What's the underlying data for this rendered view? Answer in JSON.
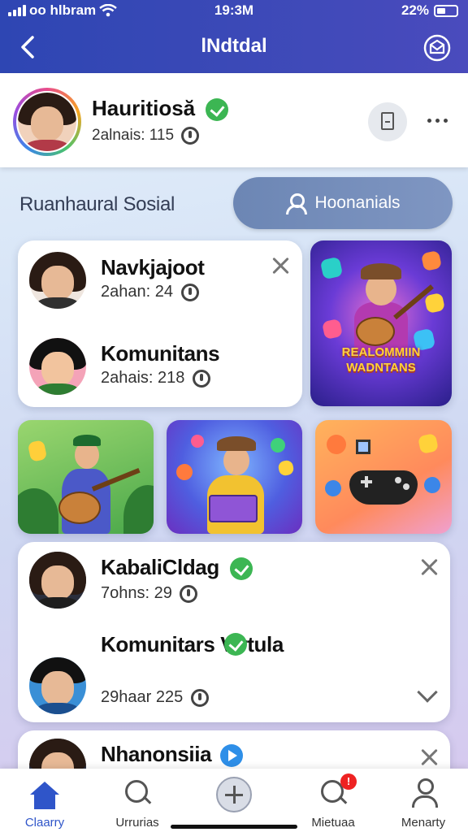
{
  "status_bar": {
    "carrier": "oo hlbram",
    "time": "19:3M",
    "battery": "22%"
  },
  "header": {
    "title": "lNdtdal"
  },
  "profile": {
    "name": "Hauritiosă",
    "sub": "2alnais: 115"
  },
  "section": {
    "title": "Ruanhaural Sosial",
    "button_label": "Hoonanials"
  },
  "card1": {
    "rows": [
      {
        "name": "Navkjajoot",
        "sub": "2ahan: 24"
      },
      {
        "name": "Komunitans",
        "sub": "2ahais: 218"
      }
    ]
  },
  "tiles": {
    "banner_text": "REALOMMIIN WADNTANS"
  },
  "card2": {
    "rows": [
      {
        "name": "KabaliCldag",
        "sub": "7ohns: 29"
      },
      {
        "name": "Komunitars Virtula",
        "sub": "29haar 225"
      }
    ]
  },
  "card3": {
    "name": "Nhanonsiia"
  },
  "bottom_nav": {
    "items": [
      {
        "label": "Claarry"
      },
      {
        "label": "Urrurias"
      },
      {
        "label": ""
      },
      {
        "label": "Mietuaa",
        "badge": "!"
      },
      {
        "label": "Menarty"
      }
    ]
  },
  "colors": {
    "top_bar": "#3a48b6",
    "accent_blue": "#2f55c9",
    "verified_green": "#3cb653",
    "notification_red": "#e22222"
  },
  "icons": [
    "back-arrow-icon",
    "mail-icon",
    "verified-icon",
    "document-icon",
    "more-icon",
    "person-icon",
    "close-icon",
    "chevron-down-icon",
    "home-icon",
    "search-icon",
    "add-icon",
    "notification-icon",
    "member-icon"
  ]
}
